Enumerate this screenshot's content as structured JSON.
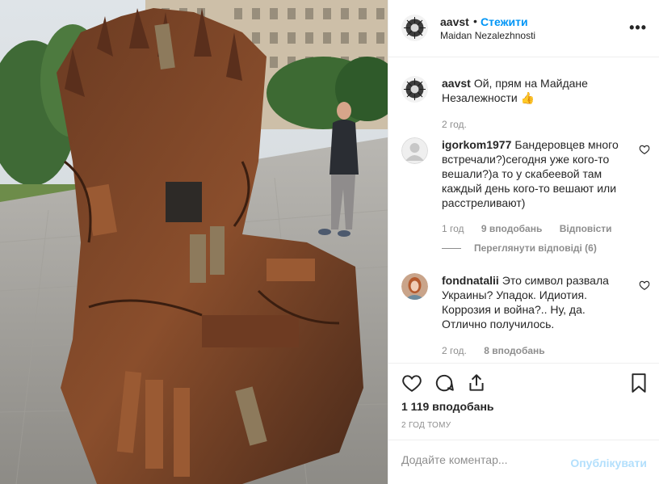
{
  "post": {
    "username": "aavst",
    "separator": "•",
    "follow_label": "Стежити",
    "location": "Maidan Nezalezhnosti",
    "more_icon": "more-horizontal-icon"
  },
  "caption": {
    "username": "aavst",
    "text": "Ой, прям на Майдане Незалежности 👍",
    "time": "2 год."
  },
  "comments": [
    {
      "username": "igorkom1977",
      "text": "Бандеровцев много встречали?)сегодня уже кого-то вешали?)а то у скабеевой там каждый день кого-то вешают или расстреливают)",
      "time": "1 год",
      "likes": "9 вподобань",
      "reply_label": "Відповісти",
      "view_replies": "Переглянути відповіді (6)"
    },
    {
      "username": "fondnatalii",
      "text": "Это символ развала Украины? Упадок. Идиотия. Коррозия и война?.. Ну, да. Отлично получилось.",
      "time": "2 год.",
      "likes": "8 вподобань"
    }
  ],
  "actions": {
    "like_icon": "heart-icon",
    "comment_icon": "comment-icon",
    "share_icon": "share-icon",
    "save_icon": "bookmark-icon"
  },
  "likes_count": "1 119 вподобань",
  "posted_time": "2 ГОД ТОМУ",
  "add_comment": {
    "placeholder": "Додайте коментар...",
    "publish_label": "Опублікувати"
  },
  "colors": {
    "accent": "#0095f6",
    "publish_disabled": "#b2dffc",
    "muted": "#8e8e8e",
    "border": "#efefef"
  }
}
